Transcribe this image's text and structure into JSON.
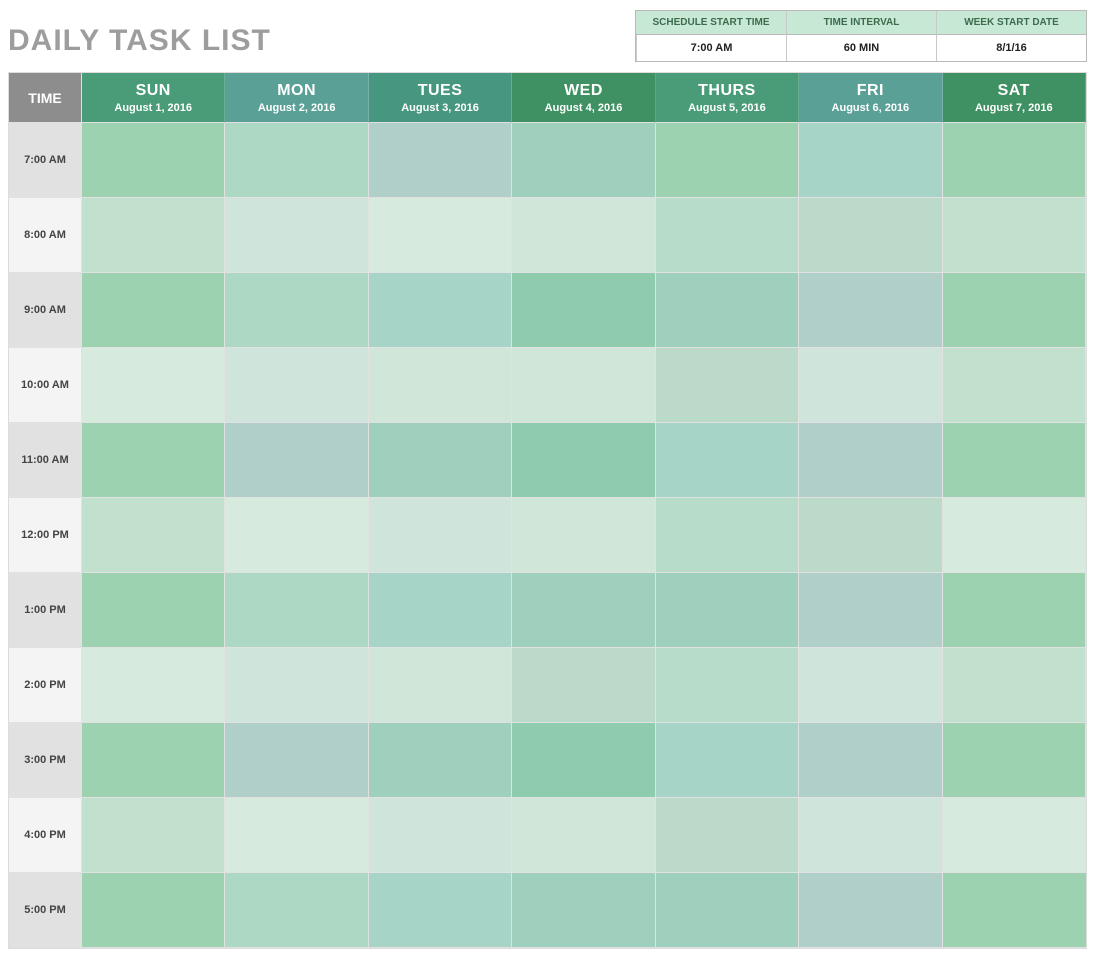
{
  "title": "DAILY TASK LIST",
  "settings": {
    "headers": [
      "SCHEDULE START TIME",
      "TIME INTERVAL",
      "WEEK START DATE"
    ],
    "values": [
      "7:00 AM",
      "60 MIN",
      "8/1/16"
    ]
  },
  "corner_label": "TIME",
  "days": [
    {
      "short": "SUN",
      "date": "August 1, 2016"
    },
    {
      "short": "MON",
      "date": "August 2, 2016"
    },
    {
      "short": "TUES",
      "date": "August 3, 2016"
    },
    {
      "short": "WED",
      "date": "August 4, 2016"
    },
    {
      "short": "THURS",
      "date": "August 5, 2016"
    },
    {
      "short": "FRI",
      "date": "August 6, 2016"
    },
    {
      "short": "SAT",
      "date": "August 7, 2016"
    }
  ],
  "times": [
    "7:00 AM",
    "8:00 AM",
    "9:00 AM",
    "10:00 AM",
    "11:00 AM",
    "12:00 PM",
    "1:00 PM",
    "2:00 PM",
    "3:00 PM",
    "4:00 PM",
    "5:00 PM"
  ],
  "header_colors": [
    "g-dark",
    "g-teal",
    "g-teal2",
    "g-forest",
    "g-dark",
    "g-teal",
    "g-forest"
  ],
  "row_palettes": [
    [
      "c-a",
      "c-b",
      "c-c",
      "c-d",
      "c-a",
      "c-i",
      "c-a"
    ],
    [
      "c-e",
      "c-f",
      "c-g",
      "c-j",
      "c-h",
      "c-l",
      "c-e"
    ],
    [
      "c-a",
      "c-b",
      "c-i",
      "c-k",
      "c-d",
      "c-c",
      "c-a"
    ],
    [
      "c-g",
      "c-f",
      "c-j",
      "c-j",
      "c-l",
      "c-f",
      "c-e"
    ],
    [
      "c-a",
      "c-c",
      "c-d",
      "c-k",
      "c-i",
      "c-c",
      "c-a"
    ],
    [
      "c-e",
      "c-g",
      "c-f",
      "c-j",
      "c-h",
      "c-l",
      "c-g"
    ],
    [
      "c-a",
      "c-b",
      "c-i",
      "c-d",
      "c-d",
      "c-c",
      "c-a"
    ],
    [
      "c-g",
      "c-f",
      "c-j",
      "c-l",
      "c-h",
      "c-f",
      "c-e"
    ],
    [
      "c-a",
      "c-c",
      "c-d",
      "c-k",
      "c-i",
      "c-c",
      "c-a"
    ],
    [
      "c-e",
      "c-g",
      "c-f",
      "c-j",
      "c-l",
      "c-f",
      "c-g"
    ],
    [
      "c-a",
      "c-b",
      "c-i",
      "c-d",
      "c-d",
      "c-c",
      "c-a"
    ]
  ]
}
